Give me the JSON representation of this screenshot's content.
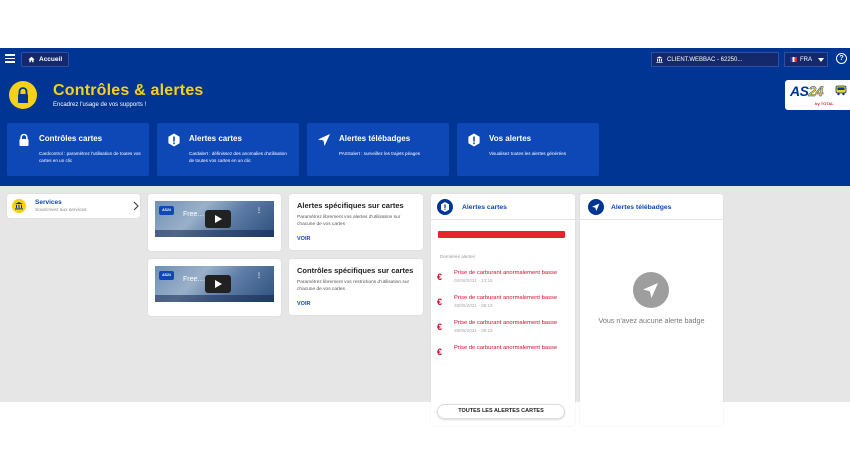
{
  "topbar": {
    "home_label": "Accueil",
    "client_label": "CLIENT.WEBBAC - 62250...",
    "lang_label": "FRA"
  },
  "page": {
    "title": "Contrôles & alertes",
    "subtitle": "Encadrez l'usage de vos supports !"
  },
  "logo": {
    "text_main": "AS",
    "text_accent": "24",
    "sub": "by TOTAL"
  },
  "features": [
    {
      "title": "Contrôles cartes",
      "desc": "Cardcontrol : paramétrez l'utilisation de toutes vos cartes en un clic",
      "icon": "lock-icon"
    },
    {
      "title": "Alertes cartes",
      "desc": "Cardalert : définissez des anomalies d'utilisation de toutes vos cartes en un clic",
      "icon": "alert-icon"
    },
    {
      "title": "Alertes télébadges",
      "desc": "PASSalert : surveillez les trajets péages",
      "icon": "navigation-icon"
    },
    {
      "title": "Vos alertes",
      "desc": "Visualisez toutes les alertes générées",
      "icon": "alert-icon"
    }
  ],
  "services": {
    "title": "Services",
    "subtitle": "Souscrivez aux services"
  },
  "videos": [
    {
      "logo": "AS24",
      "title": "Free…",
      "dots": "⋮"
    },
    {
      "logo": "AS24",
      "title": "Free…",
      "dots": "⋮"
    }
  ],
  "specific": [
    {
      "title": "Alertes spécifiques sur cartes",
      "desc": "Paramétrez librement vos alertes d'utilisation sur chacune de vos cartes",
      "link": "VOIR"
    },
    {
      "title": "Contrôles spécifiques sur cartes",
      "desc": "Paramétrez librement vos restrictions d'utilisation sur chacune de vos cartes",
      "link": "VOIR"
    }
  ],
  "alerts_card": {
    "title": "Alertes cartes",
    "section_label": "Dernières alertes",
    "items": [
      {
        "title": "Prise de carburant anormalement basse",
        "date": "02/06/2021 - 13:16"
      },
      {
        "title": "Prise de carburant anormalement basse",
        "date": "28/05/2021 - 08:16"
      },
      {
        "title": "Prise de carburant anormalement basse",
        "date": "28/05/2021 - 08:16"
      },
      {
        "title": "Prise de carburant anormalement basse",
        "date": ""
      }
    ],
    "all_button": "TOUTES LES ALERTES CARTES",
    "bar_color": "#e2262c"
  },
  "badges_card": {
    "title": "Alertes télébadges",
    "empty_text": "Vous n'avez aucune alerte badge"
  },
  "colors": {
    "primary": "#003594",
    "accent": "#f7d117",
    "alert": "#c8102e"
  }
}
